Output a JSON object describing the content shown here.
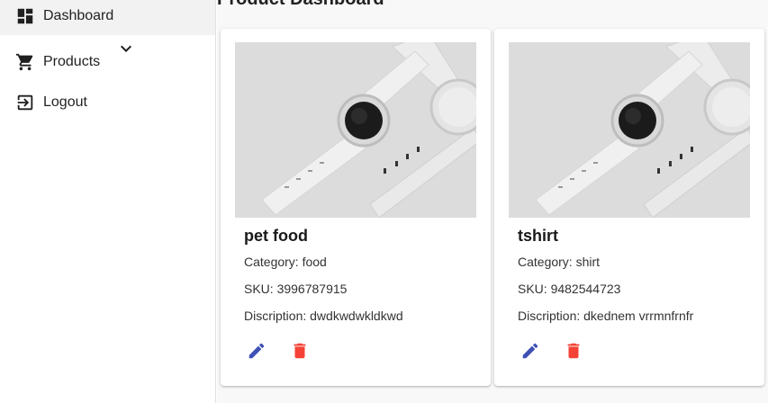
{
  "sidebar": {
    "items": [
      {
        "label": "Dashboard",
        "icon": "dashboard-icon"
      },
      {
        "label": "Products",
        "icon": "cart-icon"
      },
      {
        "label": "Logout",
        "icon": "logout-icon"
      }
    ]
  },
  "page": {
    "title": "Product Dashboard"
  },
  "products": [
    {
      "name": "pet food",
      "category": "Category: food",
      "sku": "SKU: 3996787915",
      "description": "Discription: dwdkwdwkldkwd",
      "image": "smartwatch-photo"
    },
    {
      "name": "tshirt",
      "category": "Category: shirt",
      "sku": "SKU: 9482544723",
      "description": "Discription: dkednem vrrmnfrnfr",
      "image": "smartwatch-photo"
    }
  ],
  "colors": {
    "edit": "#3f51b5",
    "delete": "#f44336",
    "sidebar_active": "#f2f2f2",
    "content_bg": "#f8f8f8"
  }
}
